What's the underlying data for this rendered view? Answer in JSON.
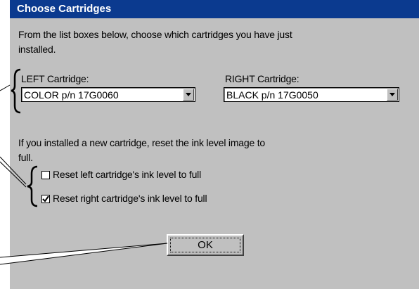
{
  "dialog": {
    "title": "Choose Cartridges",
    "intro_line1": "From the list boxes below, choose which cartridges you have just",
    "intro_line2": "installed."
  },
  "left_cartridge": {
    "label": "LEFT Cartridge:",
    "selected": "COLOR p/n 17G0060"
  },
  "right_cartridge": {
    "label": "RIGHT Cartridge:",
    "selected": "BLACK p/n 17G0050"
  },
  "reset_info": {
    "line1": "If you installed a new cartridge, reset the ink level image to",
    "line2": "full."
  },
  "checkboxes": [
    {
      "label": "Reset left cartridge's ink level to full",
      "checked": false
    },
    {
      "label": "Reset right cartridge's ink level to full",
      "checked": true
    }
  ],
  "ok_button": {
    "label": "OK"
  },
  "icons": [
    "dropdown-arrow-icon",
    "checkmark-icon"
  ],
  "colors": {
    "titlebar": "#0b3a8f",
    "dialog_bg": "#c0c0c0"
  }
}
